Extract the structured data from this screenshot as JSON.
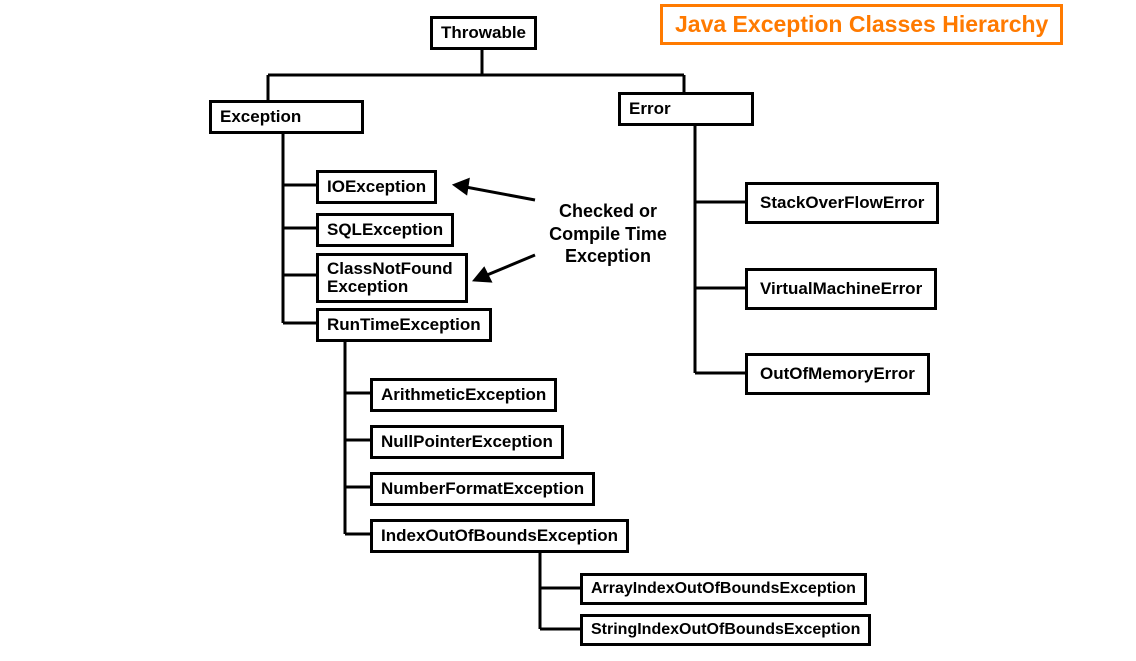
{
  "title": "Java Exception Classes Hierarchy",
  "annotation": "Checked or Compile Time Exception",
  "nodes": {
    "throwable": "Throwable",
    "exception": "Exception",
    "error": "Error",
    "ioexception": "IOException",
    "sqlexception": "SQLException",
    "classnotfound": "ClassNotFound Exception",
    "runtime": "RunTimeException",
    "arithmetic": "ArithmeticException",
    "nullpointer": "NullPointerException",
    "numberformat": "NumberFormatException",
    "indexoob": "IndexOutOfBoundsException",
    "arrayindex": "ArrayIndexOutOfBoundsException",
    "stringindex": "StringIndexOutOfBoundsException",
    "stackoverflow": "StackOverFlowError",
    "virtualmachine": "VirtualMachineError",
    "outofmemory": "OutOfMemoryError"
  }
}
